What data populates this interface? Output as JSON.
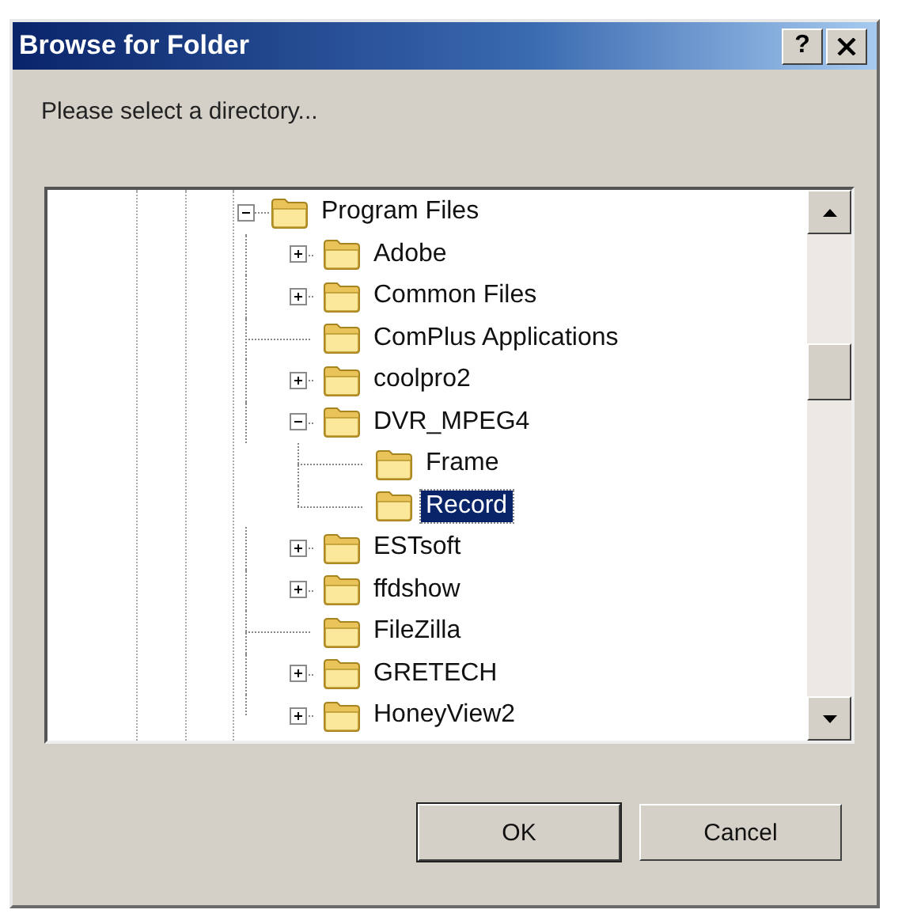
{
  "window": {
    "title": "Browse for Folder",
    "buttons": [
      "?"
    ]
  },
  "prompt": "Please select a directory...",
  "tree": {
    "items": [
      {
        "label": "Program Files",
        "kind": "node",
        "expanded": true,
        "selected": false,
        "children": [
          {
            "label": "Adobe",
            "kind": "node",
            "expanded": false,
            "selected": false
          },
          {
            "label": "Common Files",
            "kind": "node",
            "expanded": false,
            "selected": false
          },
          {
            "label": "ComPlus Applications",
            "kind": "leaf",
            "selected": false
          },
          {
            "label": "coolpro2",
            "kind": "node",
            "expanded": false,
            "selected": false
          },
          {
            "label": "DVR_MPEG4",
            "kind": "node",
            "expanded": true,
            "selected": false,
            "children": [
              {
                "label": "Frame",
                "kind": "leaf",
                "selected": false
              },
              {
                "label": "Record",
                "kind": "leaf",
                "selected": true
              }
            ]
          },
          {
            "label": "ESTsoft",
            "kind": "node",
            "expanded": false,
            "selected": false
          },
          {
            "label": "ffdshow",
            "kind": "node",
            "expanded": false,
            "selected": false
          },
          {
            "label": "FileZilla",
            "kind": "leaf",
            "selected": false
          },
          {
            "label": "GRETECH",
            "kind": "node",
            "expanded": false,
            "selected": false
          },
          {
            "label": "HoneyView2",
            "kind": "node",
            "expanded": false,
            "selected": false
          }
        ]
      }
    ]
  },
  "buttons": [
    {
      "label": "OK",
      "default": true
    },
    {
      "label": "Cancel",
      "default": false
    }
  ]
}
